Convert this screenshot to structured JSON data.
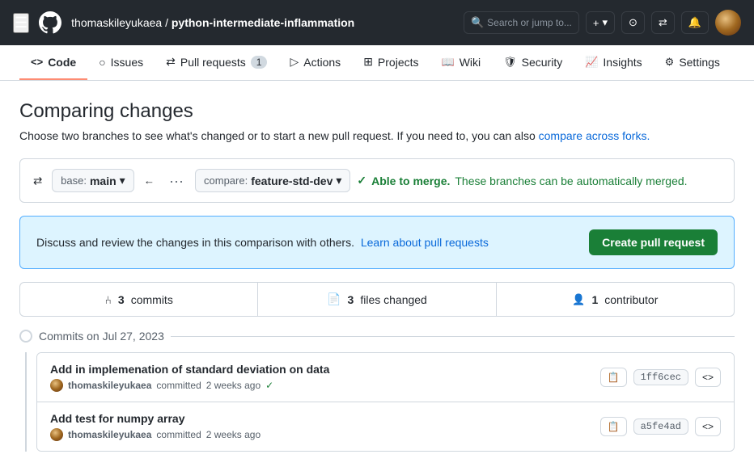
{
  "header": {
    "hamburger": "☰",
    "logo_alt": "GitHub",
    "repo_owner": "thomaskileyukaea",
    "repo_separator": "/",
    "repo_name": "python-intermediate-inflammation",
    "search_placeholder": "Search or jump to...",
    "search_label": "Search",
    "new_label": "+",
    "new_dropdown": "▾",
    "notifications_label": "Notifications",
    "pull_requests_global_label": "Pull Requests",
    "issues_global_label": "Issues"
  },
  "nav": {
    "items": [
      {
        "id": "code",
        "label": "Code",
        "icon": "<>",
        "active": true,
        "badge": null
      },
      {
        "id": "issues",
        "label": "Issues",
        "icon": "○",
        "active": false,
        "badge": null
      },
      {
        "id": "pull-requests",
        "label": "Pull requests",
        "icon": "⇄",
        "active": false,
        "badge": "1"
      },
      {
        "id": "actions",
        "label": "Actions",
        "icon": "▷",
        "active": false,
        "badge": null
      },
      {
        "id": "projects",
        "label": "Projects",
        "icon": "⊞",
        "active": false,
        "badge": null
      },
      {
        "id": "wiki",
        "label": "Wiki",
        "icon": "📖",
        "active": false,
        "badge": null
      },
      {
        "id": "security",
        "label": "Security",
        "icon": "🛡",
        "active": false,
        "badge": null
      },
      {
        "id": "insights",
        "label": "Insights",
        "icon": "📈",
        "active": false,
        "badge": null
      },
      {
        "id": "settings",
        "label": "Settings",
        "icon": "⚙",
        "active": false,
        "badge": null
      }
    ]
  },
  "compare": {
    "title": "Comparing changes",
    "subtitle": "Choose two branches to see what's changed or to start a new pull request. If you need to, you can also",
    "subtitle_link_text": "compare across forks.",
    "base_label": "base:",
    "base_value": "main",
    "compare_label": "compare:",
    "compare_value": "feature-std-dev",
    "merge_check": "✓",
    "merge_status_bold": "Able to merge.",
    "merge_status_text": "These branches can be automatically merged.",
    "info_text": "Discuss and review the changes in this comparison with others.",
    "info_link_text": "Learn about pull requests",
    "create_pr_label": "Create pull request"
  },
  "stats": {
    "commits_icon": "⑃",
    "commits_count": "3",
    "commits_label": "commits",
    "files_icon": "📄",
    "files_count": "3",
    "files_label": "files changed",
    "contributors_icon": "👤",
    "contributors_count": "1",
    "contributors_label": "contributor"
  },
  "commits_section": {
    "date_label": "Commits on Jul 27, 2023",
    "commits": [
      {
        "id": "commit-1",
        "title": "Add in implemenation of standard deviation on data",
        "author": "thomaskileyukaea",
        "action": "committed",
        "time": "2 weeks ago",
        "check": "✓",
        "hash": "1ff6cec",
        "copy_label": "📋",
        "code_label": "<>"
      },
      {
        "id": "commit-2",
        "title": "Add test for numpy array",
        "author": "thomaskileyukaea",
        "action": "committed",
        "time": "2 weeks ago",
        "check": "",
        "hash": "a5fe4ad",
        "copy_label": "📋",
        "code_label": "<>"
      }
    ]
  },
  "colors": {
    "accent_red": "#fd8c73",
    "link_blue": "#0969da",
    "green": "#1a7f37",
    "info_bg": "#ddf4ff",
    "info_border": "#54aeff"
  }
}
